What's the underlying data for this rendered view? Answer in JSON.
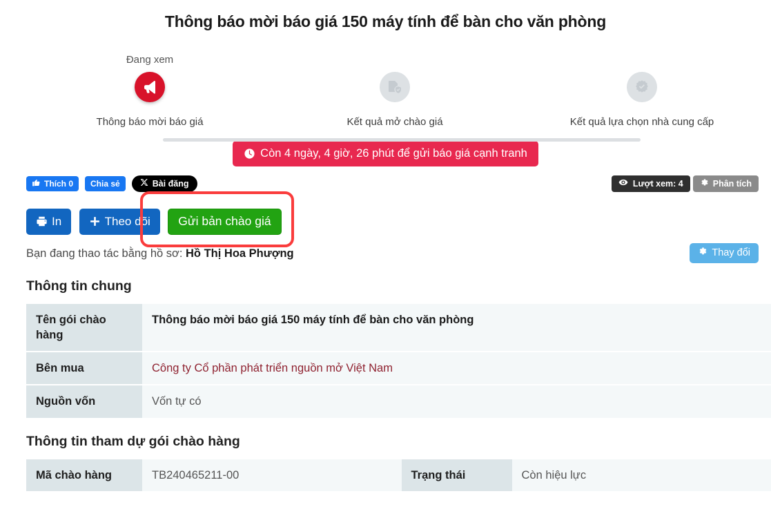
{
  "page": {
    "title": "Thông báo mời báo giá 150 máy tính để bàn cho văn phòng"
  },
  "stepper": {
    "current_marker": "Đang xem",
    "steps": [
      {
        "label": "Thông báo mời báo giá",
        "icon": "megaphone-icon",
        "state": "active"
      },
      {
        "label": "Kết quả mở chào giá",
        "icon": "document-shield-check-icon",
        "state": "inactive"
      },
      {
        "label": "Kết quả lựa chọn nhà cung cấp",
        "icon": "award-check-icon",
        "state": "inactive"
      }
    ]
  },
  "countdown": {
    "text": "Còn 4 ngày, 4 giờ, 26 phút để gửi báo giá cạnh tranh",
    "icon": "clock-icon",
    "color": "#e8284f"
  },
  "social": {
    "facebook_like_label": "Thích 0",
    "facebook_share_label": "Chia sẻ",
    "x_post_label": "Bài đăng",
    "views_label": "Lượt xem: 4",
    "analytics_label": "Phân tích"
  },
  "actions": {
    "print_label": "In",
    "follow_label": "Theo dõi",
    "submit_quote_label": "Gửi bản chào giá",
    "submit_quote_color": "#22a312",
    "highlight_color": "#fa3c3c"
  },
  "profile": {
    "prefix": "Bạn đang thao tác bằng hồ sơ:",
    "name": "Hồ Thị Hoa Phượng",
    "change_label": "Thay đổi"
  },
  "general_info": {
    "heading": "Thông tin chung",
    "rows": [
      {
        "key": "Tên gói chào hàng",
        "value": "Thông báo mời báo giá 150 máy tính để bàn cho văn phòng"
      },
      {
        "key": "Bên mua",
        "value": "Công ty Cổ phần phát triển nguồn mở Việt Nam"
      },
      {
        "key": "Nguồn vốn",
        "value": "Vốn tự có"
      }
    ]
  },
  "participation_info": {
    "heading": "Thông tin tham dự gói chào hàng",
    "code_key": "Mã chào hàng",
    "code_value": "TB240465211-00",
    "status_key": "Trạng thái",
    "status_value": "Còn hiệu lực"
  }
}
